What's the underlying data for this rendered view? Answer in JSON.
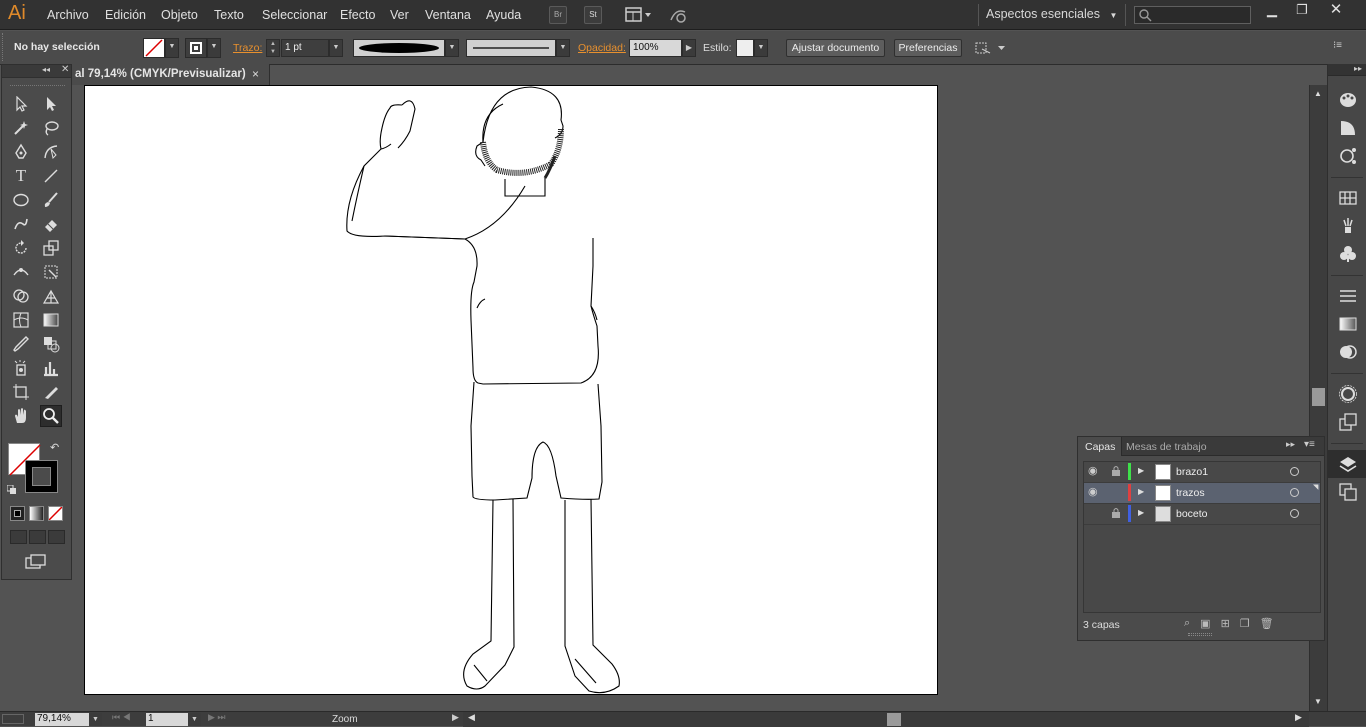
{
  "app": {
    "logo": "Ai",
    "accent": "#e08a2a"
  },
  "menu": [
    "Archivo",
    "Edición",
    "Objeto",
    "Texto",
    "Seleccionar",
    "Efecto",
    "Ver",
    "Ventana",
    "Ayuda"
  ],
  "menu_badges": {
    "br": "Br",
    "st": "St"
  },
  "workspace": {
    "label": "Aspectos esenciales"
  },
  "control_bar": {
    "selection_status": "No hay selección",
    "stroke_label": "Trazo:",
    "stroke_weight": "1 pt",
    "opacity_label": "Opacidad:",
    "opacity_value": "100%",
    "style_label": "Estilo:",
    "fit_button": "Ajustar documento",
    "prefs_button": "Preferencias"
  },
  "document": {
    "tab_title": "al 79,14% (CMYK/Previsualizar)",
    "close": "×"
  },
  "status": {
    "zoom": "79,14%",
    "page": "1",
    "tool_name": "Zoom"
  },
  "layers_panel": {
    "tabs": [
      "Capas",
      "Mesas de trabajo"
    ],
    "layers": [
      {
        "name": "brazo1",
        "color": "#3ee04a",
        "visible": true,
        "locked": true,
        "selected": false
      },
      {
        "name": "trazos",
        "color": "#e04040",
        "visible": true,
        "locked": false,
        "selected": true
      },
      {
        "name": "boceto",
        "color": "#4060e0",
        "visible": false,
        "locked": true,
        "selected": false
      }
    ],
    "count": "3 capas"
  }
}
